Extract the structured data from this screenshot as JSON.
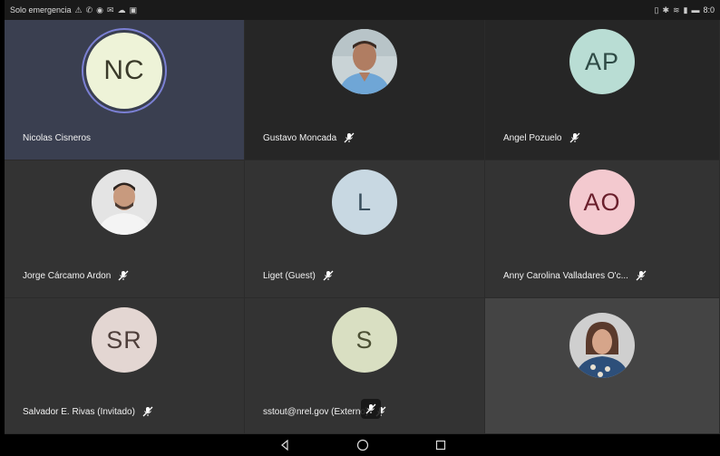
{
  "statusbar": {
    "left_text": "Solo emergencia",
    "right_time": "8:0"
  },
  "tiles": [
    {
      "name": "Nicolas Cisneros",
      "initials": "NC",
      "muted": false
    },
    {
      "name": "Gustavo Moncada",
      "initials": "",
      "muted": true
    },
    {
      "name": "Angel Pozuelo",
      "initials": "AP",
      "muted": true
    },
    {
      "name": "Jorge Cárcamo Ardon",
      "initials": "",
      "muted": true
    },
    {
      "name": "Liget (Guest)",
      "initials": "L",
      "muted": true
    },
    {
      "name": "Anny Carolina Valladares O'c...",
      "initials": "AO",
      "muted": true
    },
    {
      "name": "Salvador E. Rivas (Invitado)",
      "initials": "SR",
      "muted": true
    },
    {
      "name": "sstout@nrel.gov (Externo)",
      "initials": "S",
      "muted": true
    },
    {
      "name": "",
      "initials": "",
      "muted": false
    }
  ],
  "colors": {
    "active_ring": "#7b80d4",
    "tile_bg": "#333333",
    "active_tile_bg": "#3a3f50"
  },
  "icons": [
    "mic-off-icon",
    "back-icon",
    "home-icon",
    "recents-icon"
  ]
}
